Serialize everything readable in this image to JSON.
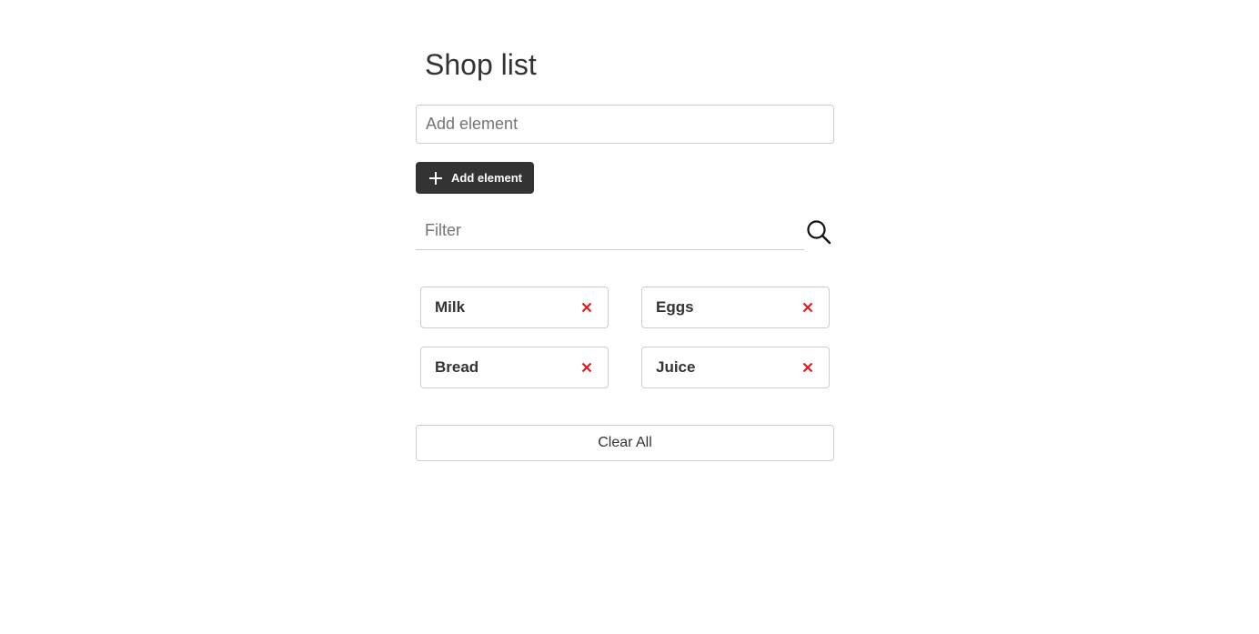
{
  "header": {
    "title": "Shop list"
  },
  "add_form": {
    "input_placeholder": "Add element",
    "input_value": "",
    "button_label": "Add element",
    "button_icon": "plus-icon"
  },
  "filter": {
    "placeholder": "Filter",
    "value": "",
    "icon": "search-icon"
  },
  "items": [
    {
      "label": "Milk",
      "remove_icon": "close-icon"
    },
    {
      "label": "Eggs",
      "remove_icon": "close-icon"
    },
    {
      "label": "Bread",
      "remove_icon": "close-icon"
    },
    {
      "label": "Juice",
      "remove_icon": "close-icon"
    }
  ],
  "clear_button": {
    "label": "Clear All"
  },
  "colors": {
    "button_dark": "#333333",
    "remove_red": "#e01b1b",
    "border": "#cccccc",
    "text": "#333333"
  }
}
